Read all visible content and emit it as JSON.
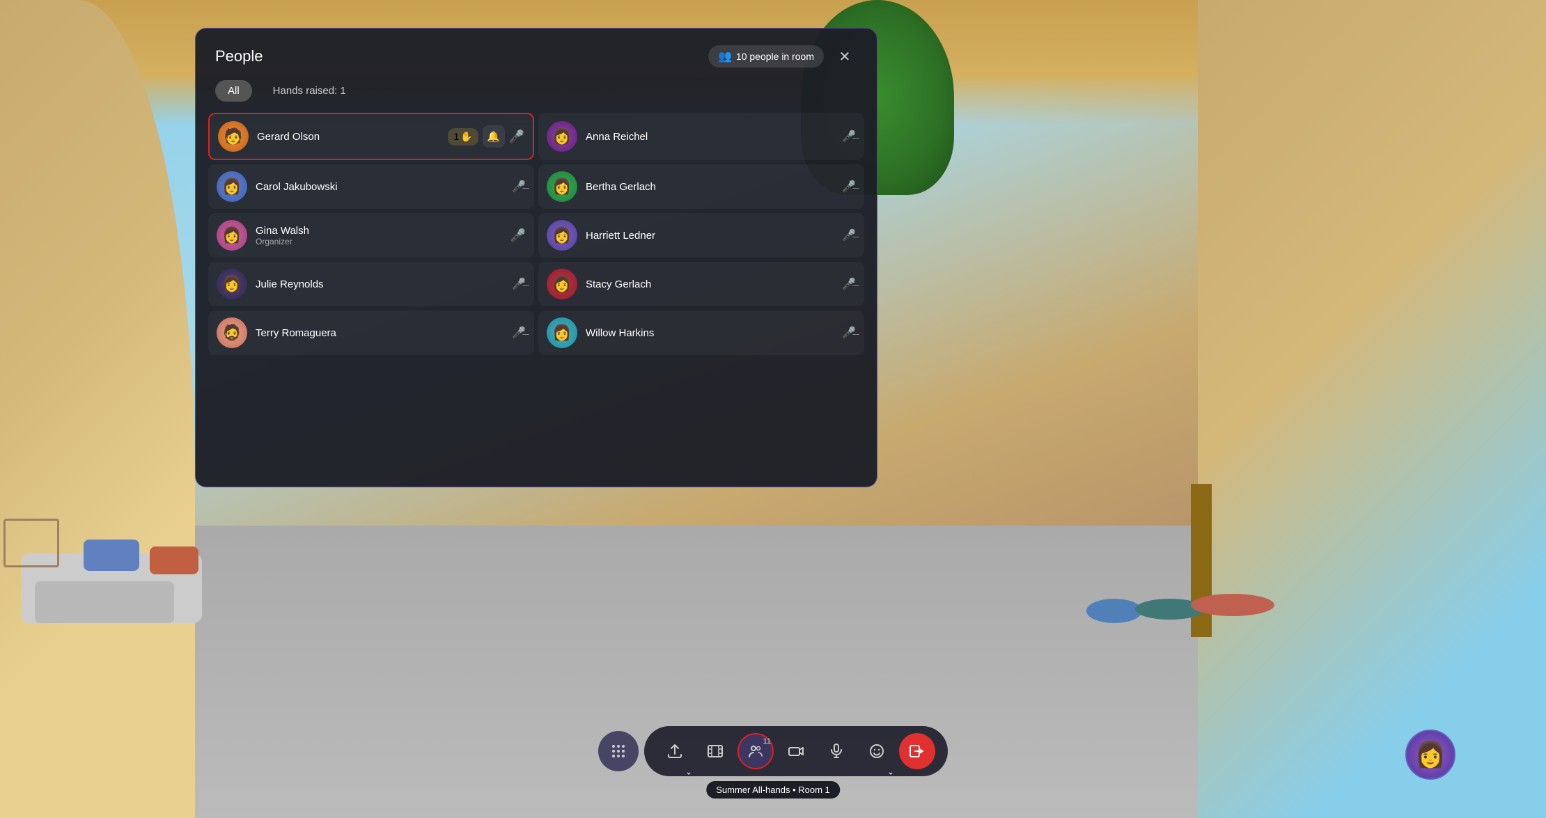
{
  "background": {
    "alt": "Virtual meeting room background"
  },
  "panel": {
    "title": "People",
    "people_count_label": "10 people in room",
    "close_label": "×",
    "tabs": [
      {
        "id": "all",
        "label": "All",
        "active": true
      },
      {
        "id": "hands",
        "label": "Hands raised: 1",
        "active": false
      }
    ],
    "people": [
      {
        "id": "gerard",
        "name": "Gerard Olson",
        "role": "",
        "avatar_emoji": "🧑",
        "avatar_class": "avatar-orange",
        "has_hand_raised": true,
        "hand_count": "1",
        "has_bell": true,
        "mic": "on",
        "highlighted": true,
        "column": "left"
      },
      {
        "id": "anna",
        "name": "Anna Reichel",
        "role": "",
        "avatar_emoji": "👩",
        "avatar_class": "avatar-red-dark",
        "has_hand_raised": false,
        "mic": "muted",
        "highlighted": false,
        "column": "right"
      },
      {
        "id": "carol",
        "name": "Carol Jakubowski",
        "role": "",
        "avatar_emoji": "👩",
        "avatar_class": "avatar-blue",
        "has_hand_raised": false,
        "mic": "muted",
        "highlighted": false,
        "column": "left"
      },
      {
        "id": "bertha",
        "name": "Bertha Gerlach",
        "role": "",
        "avatar_emoji": "👩",
        "avatar_class": "avatar-green",
        "has_hand_raised": false,
        "mic": "muted",
        "highlighted": false,
        "column": "right"
      },
      {
        "id": "gina",
        "name": "Gina Walsh",
        "role": "Organizer",
        "avatar_emoji": "👩",
        "avatar_class": "avatar-pink",
        "has_hand_raised": false,
        "mic": "on",
        "highlighted": false,
        "column": "left"
      },
      {
        "id": "harriett",
        "name": "Harriett Ledner",
        "role": "",
        "avatar_emoji": "👩",
        "avatar_class": "avatar-purple",
        "has_hand_raised": false,
        "mic": "muted",
        "highlighted": false,
        "column": "right"
      },
      {
        "id": "julie",
        "name": "Julie Reynolds",
        "role": "",
        "avatar_emoji": "👩",
        "avatar_class": "avatar-dark",
        "has_hand_raised": false,
        "mic": "muted",
        "highlighted": false,
        "column": "left"
      },
      {
        "id": "stacy",
        "name": "Stacy Gerlach",
        "role": "",
        "avatar_emoji": "👩",
        "avatar_class": "avatar-teal",
        "has_hand_raised": false,
        "mic": "muted",
        "highlighted": false,
        "column": "right"
      },
      {
        "id": "terry",
        "name": "Terry Romaguera",
        "role": "",
        "avatar_emoji": "🧔",
        "avatar_class": "avatar-peach",
        "has_hand_raised": false,
        "mic": "muted",
        "highlighted": false,
        "column": "left"
      },
      {
        "id": "willow",
        "name": "Willow Harkins",
        "role": "",
        "avatar_emoji": "👩",
        "avatar_class": "avatar-teal2",
        "has_hand_raised": false,
        "mic": "muted",
        "highlighted": false,
        "column": "right"
      }
    ]
  },
  "toolbar": {
    "buttons": [
      {
        "id": "share",
        "icon": "⬆",
        "label": "Share",
        "active": false,
        "red": false
      },
      {
        "id": "film",
        "icon": "🎬",
        "label": "Content",
        "active": false,
        "red": false
      },
      {
        "id": "people",
        "icon": "👥",
        "label": "People",
        "active": true,
        "red": false,
        "badge": "11"
      },
      {
        "id": "camera",
        "icon": "📷",
        "label": "Camera",
        "active": false,
        "red": false
      },
      {
        "id": "mic",
        "icon": "🎤",
        "label": "Mic",
        "active": false,
        "red": false
      },
      {
        "id": "emoji",
        "icon": "😊",
        "label": "React",
        "active": false,
        "red": false
      },
      {
        "id": "leave",
        "icon": "📴",
        "label": "Leave",
        "active": false,
        "red": true
      }
    ],
    "dots_icon": "⠿",
    "tooltip": "Summer All-hands • Room 1"
  },
  "self_avatar_emoji": "👩"
}
